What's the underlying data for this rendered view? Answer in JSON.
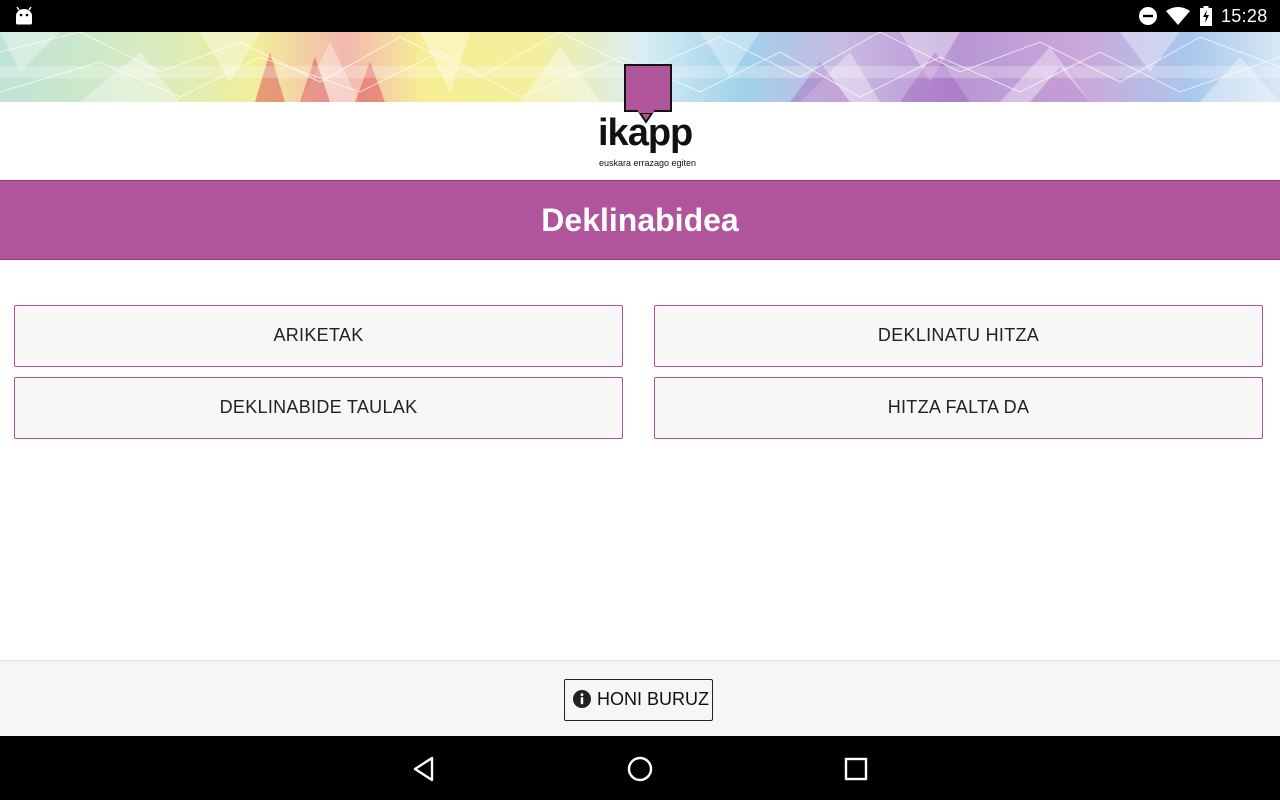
{
  "status_bar": {
    "time": "15:28",
    "icons": [
      "android-debug-icon",
      "do-not-disturb-icon",
      "wifi-icon",
      "battery-charging-icon"
    ]
  },
  "logo": {
    "name": "ikapp",
    "tagline": "euskara errazago egiten",
    "color": "#b0549b"
  },
  "header": {
    "title": "Deklinabidea",
    "color": "#b0549b"
  },
  "menu": {
    "buttons": [
      {
        "label": "ARIKETAK"
      },
      {
        "label": "DEKLINATU HITZA"
      },
      {
        "label": "DEKLINABIDE TAULAK"
      },
      {
        "label": "HITZA FALTA DA"
      }
    ]
  },
  "footer": {
    "about_label": "HONI BURUZ",
    "about_icon": "info-icon"
  },
  "navigation_bar": {
    "icons": [
      "back-icon",
      "home-icon",
      "recents-icon"
    ]
  }
}
